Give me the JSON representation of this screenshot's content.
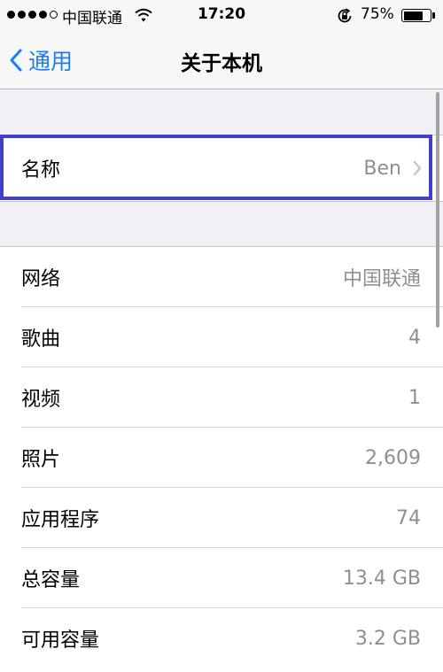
{
  "status_bar": {
    "carrier": "中国联通",
    "time": "17:20",
    "battery_percent_text": "75%",
    "battery_level": 0.75,
    "signal_strength": 4,
    "signal_max": 5
  },
  "nav": {
    "back_label": "通用",
    "title": "关于本机"
  },
  "name_row": {
    "label": "名称",
    "value": "Ben"
  },
  "info_rows": [
    {
      "label": "网络",
      "value": "中国联通"
    },
    {
      "label": "歌曲",
      "value": "4"
    },
    {
      "label": "视频",
      "value": "1"
    },
    {
      "label": "照片",
      "value": "2,609"
    },
    {
      "label": "应用程序",
      "value": "74"
    },
    {
      "label": "总容量",
      "value": "13.4 GB"
    },
    {
      "label": "可用容量",
      "value": "3.2 GB"
    }
  ],
  "colors": {
    "accent": "#1a7efb",
    "highlight": "#3f3fd0",
    "secondary_text": "#8e8e93",
    "background": "#efeff4"
  }
}
